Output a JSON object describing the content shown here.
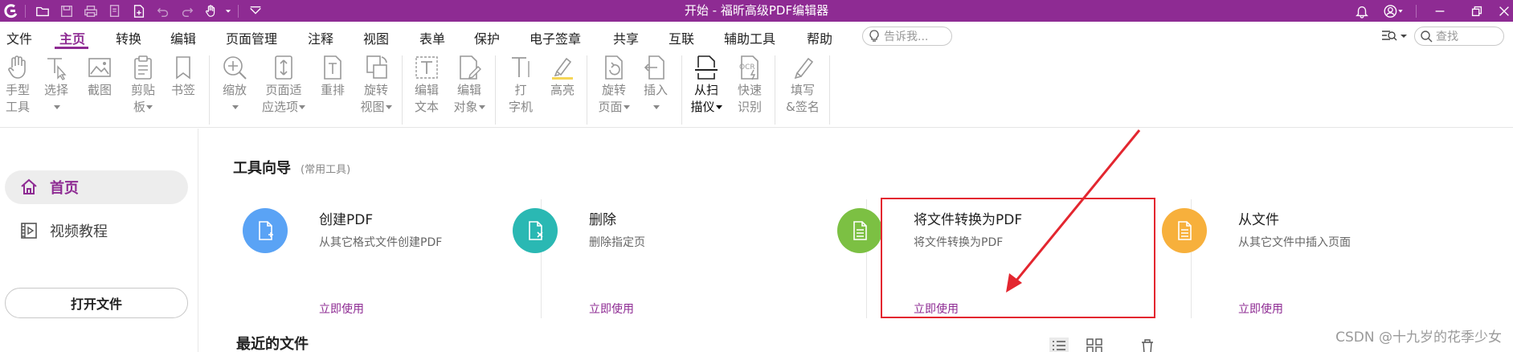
{
  "app": {
    "title": "开始 - 福昕高级PDF编辑器"
  },
  "menu": {
    "items": [
      "文件",
      "主页",
      "转换",
      "编辑",
      "页面管理",
      "注释",
      "视图",
      "表单",
      "保护",
      "电子签章",
      "共享",
      "互联",
      "辅助工具",
      "帮助"
    ],
    "active": "主页",
    "tell_me_placeholder": "告诉我...",
    "search_placeholder": "查找"
  },
  "ribbon": {
    "hand": [
      "手型",
      "工具"
    ],
    "select": [
      "选择"
    ],
    "snapshot": [
      "截图"
    ],
    "clipboard": [
      "剪贴",
      "板"
    ],
    "bookmark": [
      "书签"
    ],
    "zoom": [
      "缩放"
    ],
    "page_fit": [
      "页面适",
      "应选项"
    ],
    "reflow": [
      "重排"
    ],
    "rotate_view": [
      "旋转",
      "视图"
    ],
    "edit_text": [
      "编辑",
      "文本"
    ],
    "edit_object": [
      "编辑",
      "对象"
    ],
    "typewriter": [
      "打",
      "字机"
    ],
    "highlight": [
      "高亮"
    ],
    "rotate_page": [
      "旋转",
      "页面"
    ],
    "insert": [
      "插入"
    ],
    "scan": [
      "从扫",
      "描仪"
    ],
    "quick_ocr": [
      "快速",
      "识别"
    ],
    "fill_sign": [
      "填写",
      "&签名"
    ]
  },
  "sidebar": {
    "home": "首页",
    "video": "视频教程",
    "open_file": "打开文件"
  },
  "main": {
    "wizard_title": "工具向导",
    "wizard_subtitle": "(常用工具)",
    "cards": [
      {
        "title": "创建PDF",
        "desc": "从其它格式文件创建PDF",
        "link": "立即使用",
        "color": "#5aa3f5"
      },
      {
        "title": "删除",
        "desc": "删除指定页",
        "link": "立即使用",
        "color": "#2ab8b3"
      },
      {
        "title": "将文件转换为PDF",
        "desc": "将文件转换为PDF",
        "link": "立即使用",
        "color": "#7cc043"
      },
      {
        "title": "从文件",
        "desc": "从其它文件中插入页面",
        "link": "立即使用",
        "color": "#f7b03c"
      }
    ],
    "recent_title": "最近的文件"
  },
  "watermark": "CSDN @十九岁的花季少女",
  "colors": {
    "brand": "#8e2b93",
    "annotation": "#e3262f"
  }
}
